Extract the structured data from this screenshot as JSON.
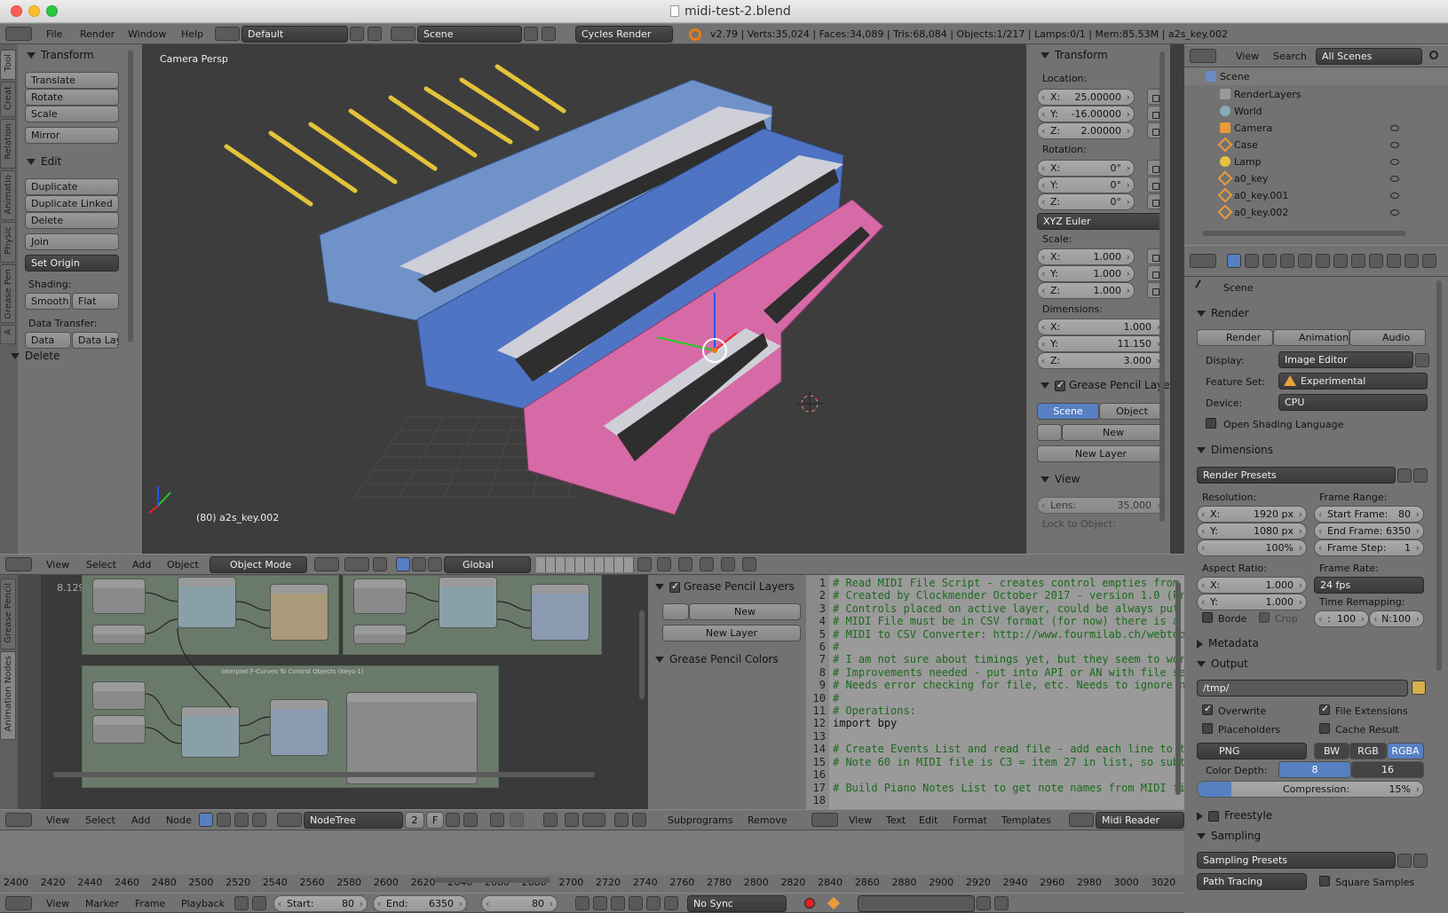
{
  "window": {
    "title": "midi-test-2.blend"
  },
  "infobar": {
    "menus": [
      "File",
      "Render",
      "Window",
      "Help"
    ],
    "layout": "Default",
    "scene": "Scene",
    "engine": "Cycles Render",
    "stats": "v2.79 | Verts:35,024 | Faces:34,089 | Tris:68,084 | Objects:1/217 | Lamps:0/1 | Mem:85.53M | a2s_key.002"
  },
  "toolshelf": {
    "tabs": [
      "Tool",
      "Creat",
      "Relation",
      "Animatio",
      "Physic",
      "Grease Pen",
      "A"
    ],
    "transform_title": "Transform",
    "translate": "Translate",
    "rotate": "Rotate",
    "scale": "Scale",
    "mirror": "Mirror",
    "edit_title": "Edit",
    "duplicate": "Duplicate",
    "duplicate_linked": "Duplicate Linked",
    "delete": "Delete",
    "join": "Join",
    "set_origin": "Set Origin",
    "shading_label": "Shading:",
    "smooth": "Smooth",
    "flat": "Flat",
    "data_transfer_label": "Data Transfer:",
    "data": "Data",
    "data_lay": "Data Lay",
    "delete_section": "Delete"
  },
  "viewport": {
    "label": "Camera Persp",
    "object_label": "(80) a2s_key.002",
    "colors": {
      "bg": "#3d3d3d",
      "blue1": "#6f93c9",
      "blue2": "#4f74c4",
      "pink": "#d66aa6",
      "pencil": "#e3c23a"
    }
  },
  "npanel": {
    "transform_title": "Transform",
    "location_label": "Location:",
    "loc": [
      {
        "a": "X:",
        "v": "25.00000"
      },
      {
        "a": "Y:",
        "v": "-16.00000"
      },
      {
        "a": "Z:",
        "v": "2.00000"
      }
    ],
    "rotation_label": "Rotation:",
    "rot": [
      {
        "a": "X:",
        "v": "0°"
      },
      {
        "a": "Y:",
        "v": "0°"
      },
      {
        "a": "Z:",
        "v": "0°"
      }
    ],
    "rot_mode": "XYZ Euler",
    "scale_label": "Scale:",
    "scl": [
      {
        "a": "X:",
        "v": "1.000"
      },
      {
        "a": "Y:",
        "v": "1.000"
      },
      {
        "a": "Z:",
        "v": "1.000"
      }
    ],
    "dimensions_label": "Dimensions:",
    "dim": [
      {
        "a": "X:",
        "v": "1.000"
      },
      {
        "a": "Y:",
        "v": "11.150"
      },
      {
        "a": "Z:",
        "v": "3.000"
      }
    ],
    "gp_layers": "Grease Pencil Layers",
    "scene_tab": "Scene",
    "object_tab": "Object",
    "new": "New",
    "new_layer": "New Layer",
    "view_title": "View",
    "lens_label": "Lens:",
    "lens_value": "35.000",
    "lock_to_object": "Lock to Object:"
  },
  "viewhdr": {
    "menus": [
      "View",
      "Select",
      "Add",
      "Object"
    ],
    "mode": "Object Mode",
    "orientation": "Global"
  },
  "outliner": {
    "menus": [
      "View",
      "Search"
    ],
    "filter": "All Scenes",
    "items": [
      {
        "label": "Scene"
      },
      {
        "label": "RenderLayers"
      },
      {
        "label": "World"
      },
      {
        "label": "Camera"
      },
      {
        "label": "Case"
      },
      {
        "label": "Lamp"
      },
      {
        "label": "a0_key"
      },
      {
        "label": "a0_key.001"
      },
      {
        "label": "a0_key.002"
      }
    ]
  },
  "props": {
    "context": "Scene",
    "render_title": "Render",
    "render_btn": "Render",
    "animation_btn": "Animation",
    "audio_btn": "Audio",
    "display_label": "Display:",
    "display": "Image Editor",
    "feature_label": "Feature Set:",
    "feature": "Experimental",
    "device_label": "Device:",
    "device": "CPU",
    "osl": "Open Shading Language",
    "dimensions_title": "Dimensions",
    "render_presets": "Render Presets",
    "resolution_label": "Resolution:",
    "res_x": "1920 px",
    "res_y": "1080 px",
    "res_pct": "100%",
    "frame_range_label": "Frame Range:",
    "start_frame": "Start Frame:",
    "start_val": "80",
    "end_frame": "End Frame:",
    "end_val": "6350",
    "frame_step": "Frame Step:",
    "step_val": "1",
    "aspect_label": "Aspect Ratio:",
    "asp_x": "1.000",
    "asp_y": "1.000",
    "frame_rate_label": "Frame Rate:",
    "fps": "24 fps",
    "time_remap": "Time Remapping:",
    "remap_old": "100",
    "remap_new": "N:100",
    "borde": "Borde",
    "crop": "Crop",
    "metadata_title": "Metadata",
    "output_title": "Output",
    "path": "/tmp/",
    "overwrite": "Overwrite",
    "file_ext": "File Extensions",
    "placeholders": "Placeholders",
    "cache_result": "Cache Result",
    "format": "PNG",
    "bw": "BW",
    "rgb": "RGB",
    "rgba": "RGBA",
    "color_depth": "Color Depth:",
    "depth8": "8",
    "depth16": "16",
    "compression_label": "Compression:",
    "compression": "15%",
    "compression_value": 0.15,
    "freestyle_title": "Freestyle",
    "sampling_title": "Sampling",
    "sampling_presets": "Sampling Presets",
    "path_tracing": "Path Tracing",
    "square_samples": "Square Samples"
  },
  "nodeeditor": {
    "tabs": [
      "Grease Pencil",
      "Animation Nodes"
    ],
    "timing": "8.1299 ms",
    "frame_label": "Interpret F-Curves To Control Objects (Keys-1)",
    "menus": [
      "View",
      "Select",
      "Add",
      "Node"
    ],
    "tree_label": "NodeTree",
    "tree_users": "2",
    "f": "F",
    "subprograms": "Subprograms",
    "remove": "Remove"
  },
  "gpanel": {
    "title": "Grease Pencil Layers",
    "new": "New",
    "new_layer": "New Layer",
    "colors_title": "Grease Pencil Colors"
  },
  "texteditor": {
    "lines": [
      "# Read MIDI File Script - creates control empties from",
      "# Created by Clockmender October 2017 - version 1.0 (Pr",
      "# Controls placed on active layer, could be always put",
      "# MIDI File must be in CSV format (for now) there is a",
      "# MIDI to CSV Converter: http://www.fourmilab.ch/webtoo",
      "#",
      "# I am not sure about timings yet, but they seem to wor",
      "# Improvements needed - put into API or AN with file se",
      "# Needs error checking for file, etc. Needs to ignore n",
      "#",
      "# Operations:",
      "import bpy",
      "",
      "# Create Events List and read file - add each line to t",
      "# Note 60 in MIDI file is C3 = item 27 in list, so subt",
      "",
      "# Build Piano Notes List to get note names from MIDI fi",
      ""
    ],
    "menus": [
      "View",
      "Text",
      "Edit",
      "Format",
      "Templates"
    ],
    "name": "Midi Reader"
  },
  "timeline": {
    "ticks": [
      "2400",
      "2420",
      "2440",
      "2460",
      "2480",
      "2500",
      "2520",
      "2540",
      "2560",
      "2580",
      "2600",
      "2620",
      "2640",
      "2660",
      "2680",
      "2700",
      "2720",
      "2740",
      "2760",
      "2780",
      "2800",
      "2820",
      "2840",
      "2860",
      "2880",
      "2900",
      "2920",
      "2940",
      "2960",
      "2980",
      "3000",
      "3020"
    ],
    "menus": [
      "View",
      "Marker",
      "Frame",
      "Playback"
    ],
    "start_label": "Start:",
    "start": "80",
    "end_label": "End:",
    "end": "6350",
    "current": "80",
    "sync": "No Sync"
  }
}
